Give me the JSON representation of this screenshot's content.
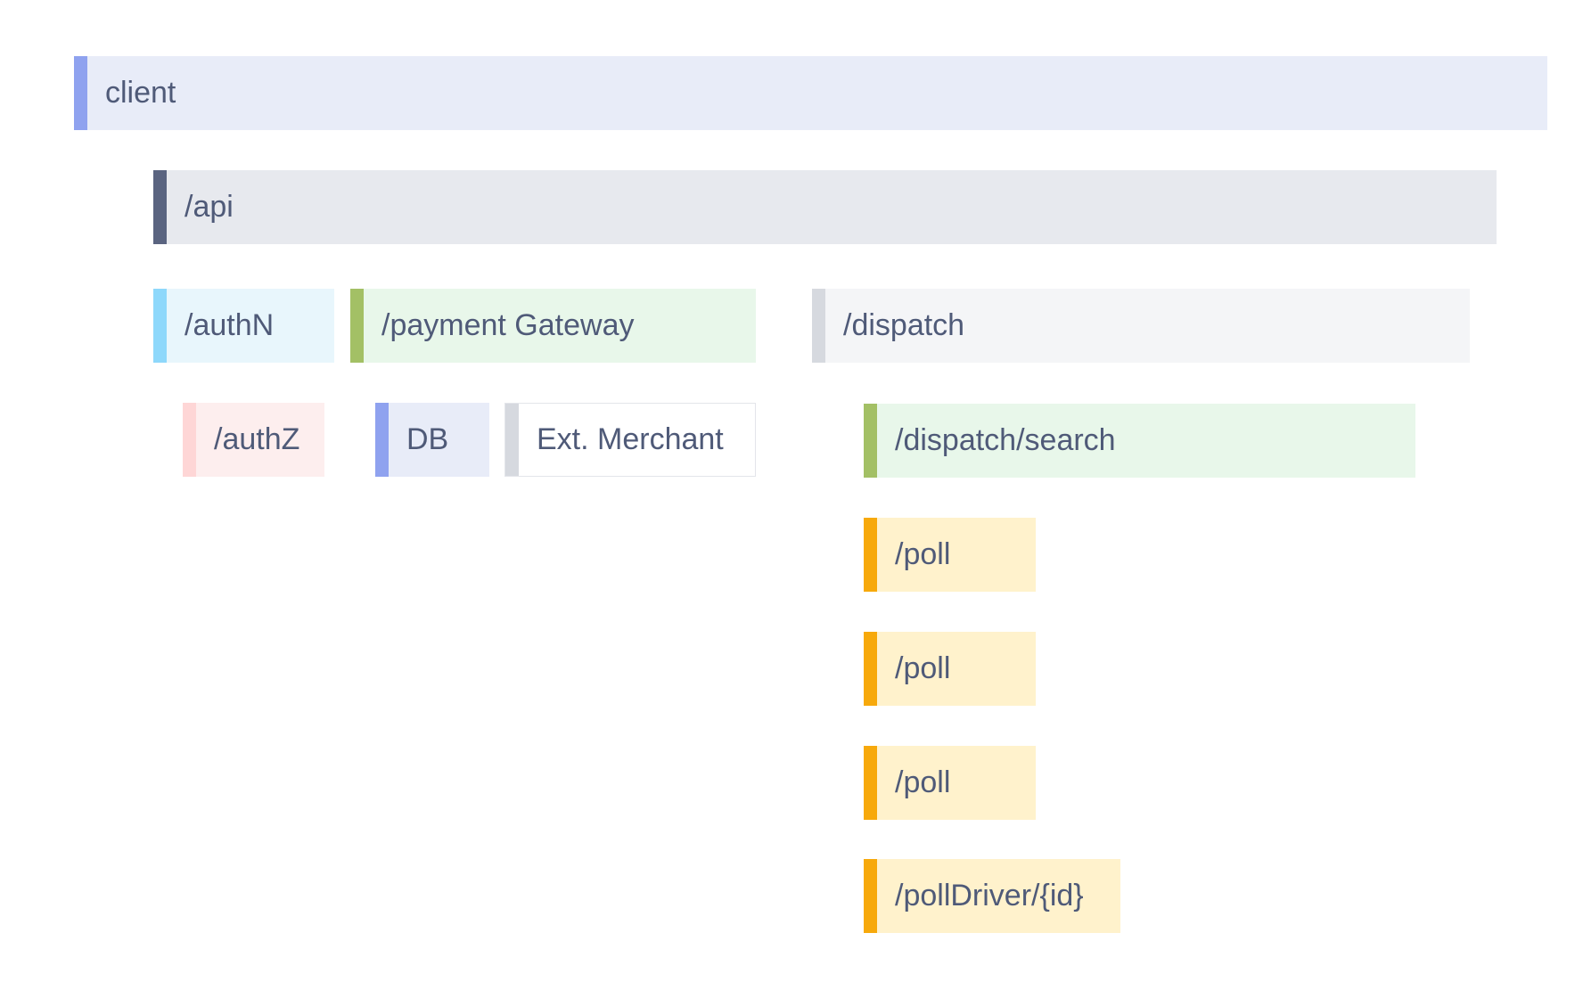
{
  "spans": [
    {
      "label": "client",
      "bg": "#e8ecf8",
      "accent": "#8fa2ef"
    },
    {
      "label": "/api",
      "bg": "#e7e9ee",
      "accent": "#5a6480"
    },
    {
      "label": "/authN",
      "bg": "#e8f6fc",
      "accent": "#8ed8fb"
    },
    {
      "label": "/payment Gateway",
      "bg": "#e8f7ea",
      "accent": "#a3c065"
    },
    {
      "label": "/dispatch",
      "bg": "#f4f5f7",
      "accent": "#d6d9df"
    },
    {
      "label": "/authZ",
      "bg": "#fdeeee",
      "accent": "#fed6d6"
    },
    {
      "label": "DB",
      "bg": "#e8ecf8",
      "accent": "#8fa2ef"
    },
    {
      "label": "Ext. Merchant",
      "bg": "#ffffff",
      "accent": "#d6d9df"
    },
    {
      "label": "/dispatch/search",
      "bg": "#e8f7ea",
      "accent": "#a3c065"
    },
    {
      "label": "/poll",
      "bg": "#fff2cc",
      "accent": "#f7a90b"
    },
    {
      "label": "/poll",
      "bg": "#fff2cc",
      "accent": "#f7a90b"
    },
    {
      "label": "/poll",
      "bg": "#fff2cc",
      "accent": "#f7a90b"
    },
    {
      "label": "/pollDriver/{id}",
      "bg": "#fff2cc",
      "accent": "#f7a90b"
    }
  ]
}
